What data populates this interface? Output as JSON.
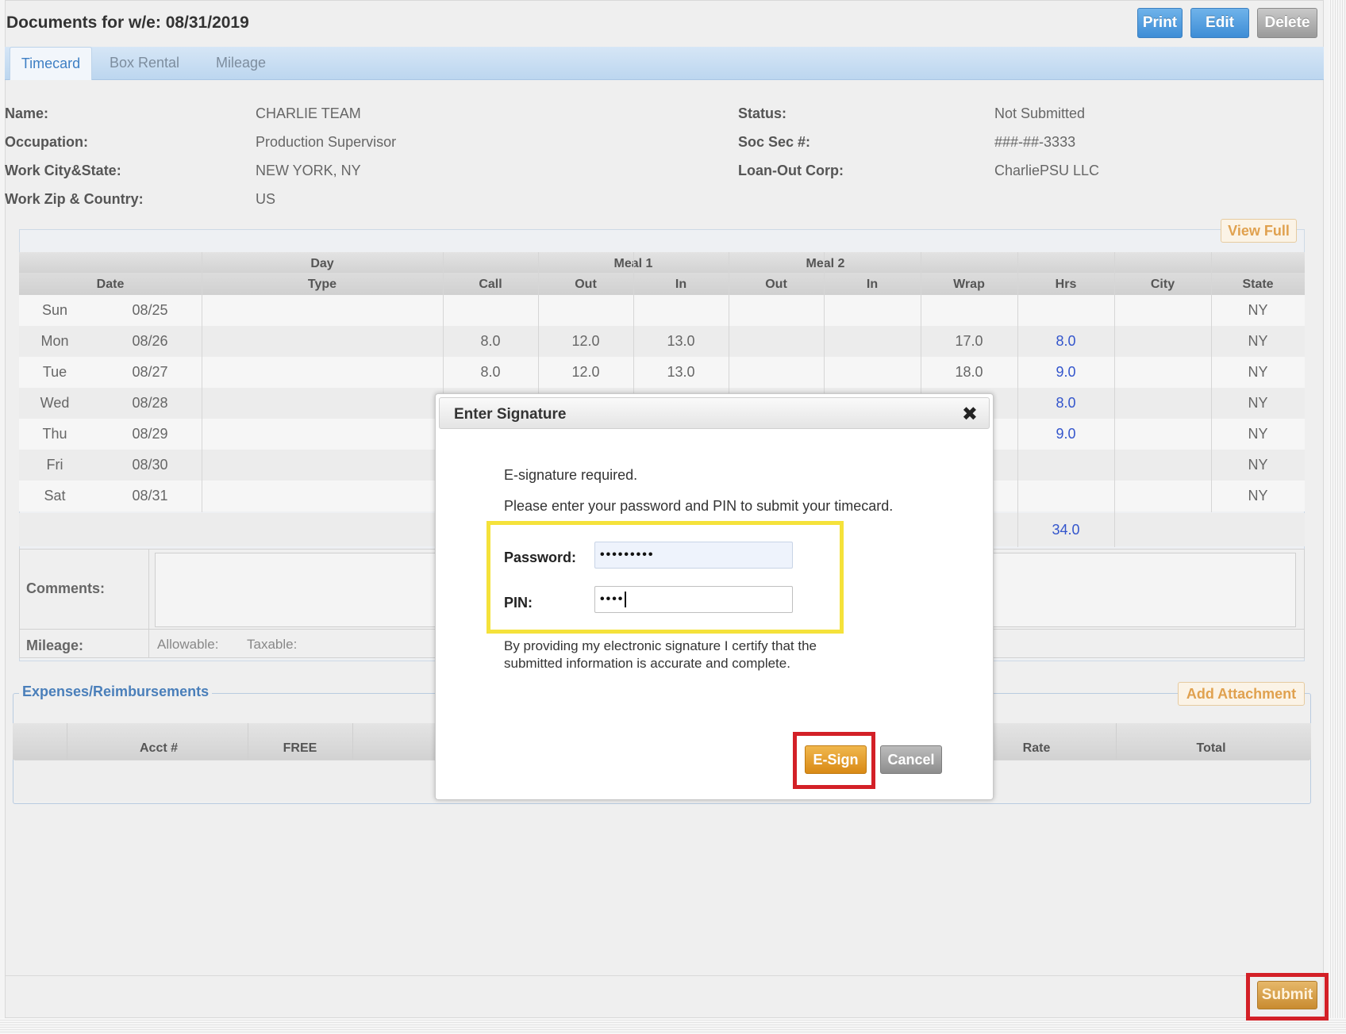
{
  "header": {
    "title": "Documents for w/e: 08/31/2019",
    "buttons": {
      "print": "Print",
      "edit": "Edit",
      "delete": "Delete"
    }
  },
  "tabs": [
    "Timecard",
    "Box Rental",
    "Mileage"
  ],
  "info": {
    "name_label": "Name:",
    "name": "CHARLIE TEAM",
    "occupation_label": "Occupation:",
    "occupation": "Production Supervisor",
    "work_city_label": "Work City&State:",
    "work_city": "NEW YORK, NY",
    "work_zip_label": "Work Zip & Country:",
    "work_zip": "US",
    "status_label": "Status:",
    "status": "Not Submitted",
    "soc_label": "Soc Sec #:",
    "soc": "###-##-3333",
    "loanout_label": "Loan-Out Corp:",
    "loanout": "CharliePSU LLC"
  },
  "grid": {
    "view_full": "View Full",
    "group_headers": {
      "day": "Day",
      "meal1": "Meal 1",
      "meal2": "Meal 2"
    },
    "columns": [
      "Date",
      "Type",
      "Call",
      "Out",
      "In",
      "Out",
      "In",
      "Wrap",
      "Hrs",
      "City",
      "State"
    ],
    "rows": [
      {
        "day": "Sun",
        "date": "08/25",
        "call": "",
        "out1": "",
        "in1": "",
        "wrap": "",
        "hrs": "",
        "state": "NY"
      },
      {
        "day": "Mon",
        "date": "08/26",
        "call": "8.0",
        "out1": "12.0",
        "in1": "13.0",
        "wrap": "17.0",
        "hrs": "8.0",
        "state": "NY"
      },
      {
        "day": "Tue",
        "date": "08/27",
        "call": "8.0",
        "out1": "12.0",
        "in1": "13.0",
        "wrap": "18.0",
        "hrs": "9.0",
        "state": "NY"
      },
      {
        "day": "Wed",
        "date": "08/28",
        "call": "",
        "out1": "",
        "in1": "",
        "wrap": "",
        "hrs": "8.0",
        "state": "NY"
      },
      {
        "day": "Thu",
        "date": "08/29",
        "call": "",
        "out1": "",
        "in1": "",
        "wrap": "",
        "hrs": "9.0",
        "state": "NY"
      },
      {
        "day": "Fri",
        "date": "08/30",
        "call": "",
        "out1": "",
        "in1": "",
        "wrap": "",
        "hrs": "",
        "state": "NY"
      },
      {
        "day": "Sat",
        "date": "08/31",
        "call": "",
        "out1": "",
        "in1": "",
        "wrap": "",
        "hrs": "",
        "state": "NY"
      }
    ],
    "total_hrs": "34.0"
  },
  "comments": {
    "comments_label": "Comments:",
    "mileage_label": "Mileage:",
    "allowable_label": "Allowable:",
    "taxable_label": "Taxable:"
  },
  "expenses": {
    "legend": "Expenses/Reimbursements",
    "add_attachment": "Add Attachment",
    "columns": {
      "acct": "Acct #",
      "free": "FREE",
      "rate": "Rate",
      "total": "Total"
    }
  },
  "submit_label": "Submit",
  "modal": {
    "title": "Enter Signature",
    "close": "✖",
    "line1": "E-signature required.",
    "line2": "Please enter your password and PIN to submit your timecard.",
    "password_label": "Password:",
    "password_value": "•••••••••",
    "pin_label": "PIN:",
    "pin_value": "••••",
    "certify_line1": "By providing my electronic signature I certify that the",
    "certify_line2": "submitted information is accurate and complete.",
    "esign_label": "E-Sign",
    "cancel_label": "Cancel"
  },
  "colors": {
    "highlight_yellow": "#f5e23a",
    "highlight_red": "#d32027",
    "primary_button": "#3e8dd6",
    "esign_button": "#d98a16"
  }
}
